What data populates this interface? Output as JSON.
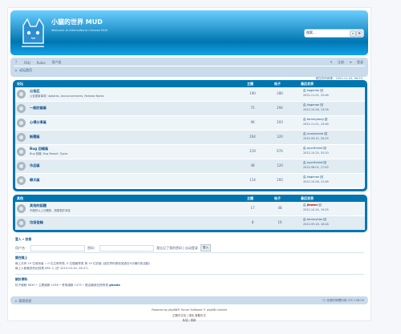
{
  "header": {
    "title": "小貓的世界 MUD",
    "description": "Welcome to KittensWorld Chinese MUD",
    "search_value": "搜索…"
  },
  "nav": {
    "left": [
      "FAQ",
      "Rules",
      "用户组"
    ],
    "right": [
      "注册",
      "登录"
    ],
    "breadcrumb": "论坛首页"
  },
  "time_line": "现在的时间是：2022-11-03, 06:53",
  "forum1": {
    "headers": [
      "论坛",
      "主题",
      "帖子",
      "最后发表"
    ],
    "rows": [
      {
        "name": "公告区",
        "desc": "公告更新事项, Updates, Announcements, Release Notes",
        "topics": "190",
        "posts": "280",
        "last": "由 kagenan 回",
        "time": "2022-11-01, 22:48"
      },
      {
        "name": "一般討論區",
        "desc": "",
        "topics": "75",
        "posts": "294",
        "last": "由 kagenan 回",
        "time": "2022-10-26, 13:26"
      },
      {
        "name": "心得分享區",
        "desc": "",
        "topics": "96",
        "posts": "203",
        "last": "由 tommytang 回",
        "time": "2022-11-01, 23:48"
      },
      {
        "name": "新聞區",
        "desc": "",
        "topics": "264",
        "posts": "320",
        "last": "由 scorpionxia 回",
        "time": "2022-09-12, 20:25"
      },
      {
        "name": "Bug 回報區",
        "desc": "Bug 回報, Bug Report, Typos",
        "topics": "219",
        "posts": "674",
        "last": "由 ayurthmist 回",
        "time": "2022-10-25, 02:20"
      },
      {
        "name": "作品區",
        "desc": "",
        "topics": "48",
        "posts": "120",
        "last": "由 ayurthmist 回",
        "time": "2022-08-01, 17:45"
      },
      {
        "name": "聊天區",
        "desc": "",
        "topics": "114",
        "posts": "260",
        "last": "由 kagenan 回",
        "time": "2022-10-08, 21:48"
      }
    ]
  },
  "forum2": {
    "headers": [
      "其他",
      "主题",
      "帖子",
      "最后发表"
    ],
    "rows": [
      {
        "name": "其他的話題",
        "desc": "不屬於以上分類的，請發表於本區",
        "topics": "17",
        "posts": "48",
        "last_prefix": "由",
        "last_user": "jiewen",
        "last_suffix": "回",
        "time": "2022-10-24, 19:25"
      },
      {
        "name": "垃圾信箱",
        "desc": "",
        "topics": "8",
        "posts": "16",
        "last": "由 tommyhan 回",
        "time": "2022-09-16, 18:48"
      }
    ]
  },
  "login": {
    "title": "登入 • 註冊",
    "user_label": "用户名：",
    "pass_label": "密码：",
    "remember": "我忘记了我的密码 | 自动登录",
    "button": "登入"
  },
  "online": {
    "title": "誰在線上",
    "line1": "線上共有 19 位使用者 :: 0 位注冊會員, 0 位隱藏會員 與 19 位訪客 (這些資料是依據過去5分鐘內的活動)",
    "line2": "線上人數最多的紀錄是 660 人 (於 2019-03-30, 06:37)"
  },
  "stats": {
    "title": "統計資料",
    "line": "帖子總數 6630 • 主題總數 1036 • 會員總數 1375 • 歡迎最新註冊會員",
    "newest": "ghosts"
  },
  "footer": {
    "left": "論壇首頁",
    "right": "全部的時間均為 UTC+08:00",
    "line1": "Powered by phpBB® Forum Software © phpBB Limited",
    "line2": "正體中文化 / 漢化 繁體中文",
    "line3": "私隱 | 條款"
  }
}
